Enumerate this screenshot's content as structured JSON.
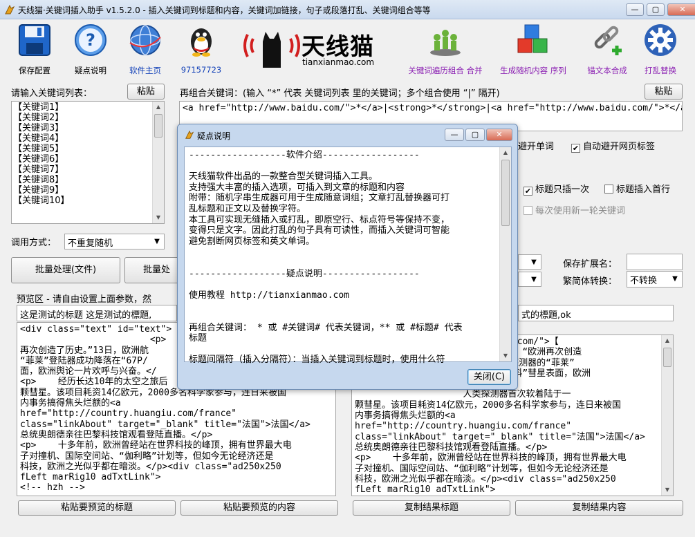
{
  "window": {
    "title": "天线猫·关键词插入助手 v1.5.2.0 - 插入关键词到标题和内容，关键词加链接，句子或段落打乱、关键词组合等等",
    "buttons": {
      "minimize": "—",
      "maximize": "▢",
      "close": "✕"
    }
  },
  "toolbar": {
    "save": "保存配置",
    "faq": "疑点说明",
    "home": "软件主页",
    "qq": "97157723",
    "brand_name": "天线猫",
    "brand_url": "tianxianmao.com",
    "traverse": "关键词遍历组合 合并",
    "random": "生成随机内容 序列",
    "anchor": "锚文本合成",
    "shuffle": "打乱替换"
  },
  "left": {
    "kw_label": "请输入关键词列表：",
    "paste": "粘贴",
    "keywords": [
      "【关键词1】",
      "【关键词2】",
      "【关键词3】",
      "【关键词4】",
      "【关键词5】",
      "【关键词6】",
      "【关键词7】",
      "【关键词8】",
      "【关键词9】",
      "【关键词10】"
    ],
    "call_label": "调用方式：",
    "call_value": "不重复随机",
    "batch_file": "批量处理(文件)",
    "batch2": "批量处"
  },
  "combo": {
    "label": "再组合关键词：(输入 “*” 代表 关键词列表 里的关键词；多个组合使用 “|” 隔开)",
    "paste": "粘贴",
    "value": "<a href=\"http://www.baidu.com/\">*</a>|<strong>*</strong>|<a href=\"http://www.baidu.com/\">*</a"
  },
  "options": {
    "avoid_word": "避开单词",
    "avoid_tag": "自动避开网页标签",
    "title_once": "标题只插一次",
    "title_first": "标题插入首行",
    "new_round": "每次使用新一轮关键词",
    "save_ext_label": "保存扩展名：",
    "save_ext_value": "",
    "conv_label": "繁简体转换：",
    "conv_value": "不转换"
  },
  "preview": {
    "label": "预览区 - 请自由设置上面参数，然",
    "title_left": "这是测试的标题 这是测试的標題,",
    "title_right": "式的標題,ok",
    "left_text": "<div class=\"text\" id=\"text\">\n                        <p>\n再次创造了历史。”13日，欧洲航\n“菲莱”登陆器成功降落在“67P/\n面，欧洲舆论一片欢呼与兴奋。</\n<p>    经历长达10年的太空之旅后\n颗彗星。该项目耗资14亿欧元，2000多名科学家参与，连日来被国\n内事务搞得焦头烂额的<a\nhref=\"http://country.huangiu.com/france\"\nclass=\"linkAbout\" target=\"_blank\" title=\"法国\">法国</a>\n总统奥朗德亲往巴黎科技馆观看登陆直播。</p>\n<p>    十多年前，欧洲曾经站在世界科技的峰顶，拥有世界最大电\n子对撞机、国际空间站、“伽利略”计划等，但如今无论经济还是\n科技，欧洲之光似乎都在暗淡。</p><div class=\"ad250x250\nfLeft marRig10 adTxtLink\">\n<!-- hzh -->",
    "right_text": "            \"http://www.baidu.com/\">【\n                     报综合报道】“欧洲再次创造\n                     塔”号彗星探测器的“菲莱”\n                     洛拉西梅纽科”彗星表面，欧洲\n\n                    人类探测器首次软着陆于一\n颗彗星。该项目耗资14亿欧元，2000多名科学家参与，连日来被国\n内事务搞得焦头烂额的<a\nhref=\"http://country.huangiu.com/france\"\nclass=\"linkAbout\" target=\"_blank\" title=\"法国\">法国</a>\n总统奥朗德亲往巴黎科技馆观看登陆直播。</p>\n<p>    十多年前，欧洲曾经站在世界科技的峰顶，拥有世界最大电\n子对撞机、国际空间站、“伽利略”计划等，但如今无论经济还是\n科技，欧洲之光似乎都在暗淡。</p><div class=\"ad250x250\nfLeft marRig10 adTxtLink\">",
    "paste_title": "粘贴要预览的标题",
    "paste_content": "粘贴要预览的内容",
    "copy_title": "复制结果标题",
    "copy_content": "复制结果内容"
  },
  "dialog": {
    "title": "疑点说明",
    "text": "------------------软件介绍------------------\n\n天线猫软件出品的一款整合型关键词插入工具。\n支持强大丰富的插入选项，可插入到文章的标题和内容\n附带：随机字串生成器可用于生成随意词组；文章打乱替换器可打\n乱标题和正文以及替换字符。\n本工具可实现无缝插入或打乱，即原空行、标点符号等保持不变，\n变得只是文字。因此打乱的句子具有可读性，而插入关键词可智能\n避免割断网页标签和英文单词。\n\n\n------------------疑点说明------------------\n\n使用教程 http://tianxianmao.com\n\n\n再组合关键词： * 或 #关键词# 代表关键词，** 或 #标题# 代表\n标题\n\n标题间隔符（插入分隔符）：当插入关键词到标题时，使用什么符",
    "close": "关闭(C)"
  },
  "colors": {
    "accent_blue": "#1442b8",
    "accent_purple": "#8a1fb2",
    "brand_red": "#d21f1f"
  }
}
